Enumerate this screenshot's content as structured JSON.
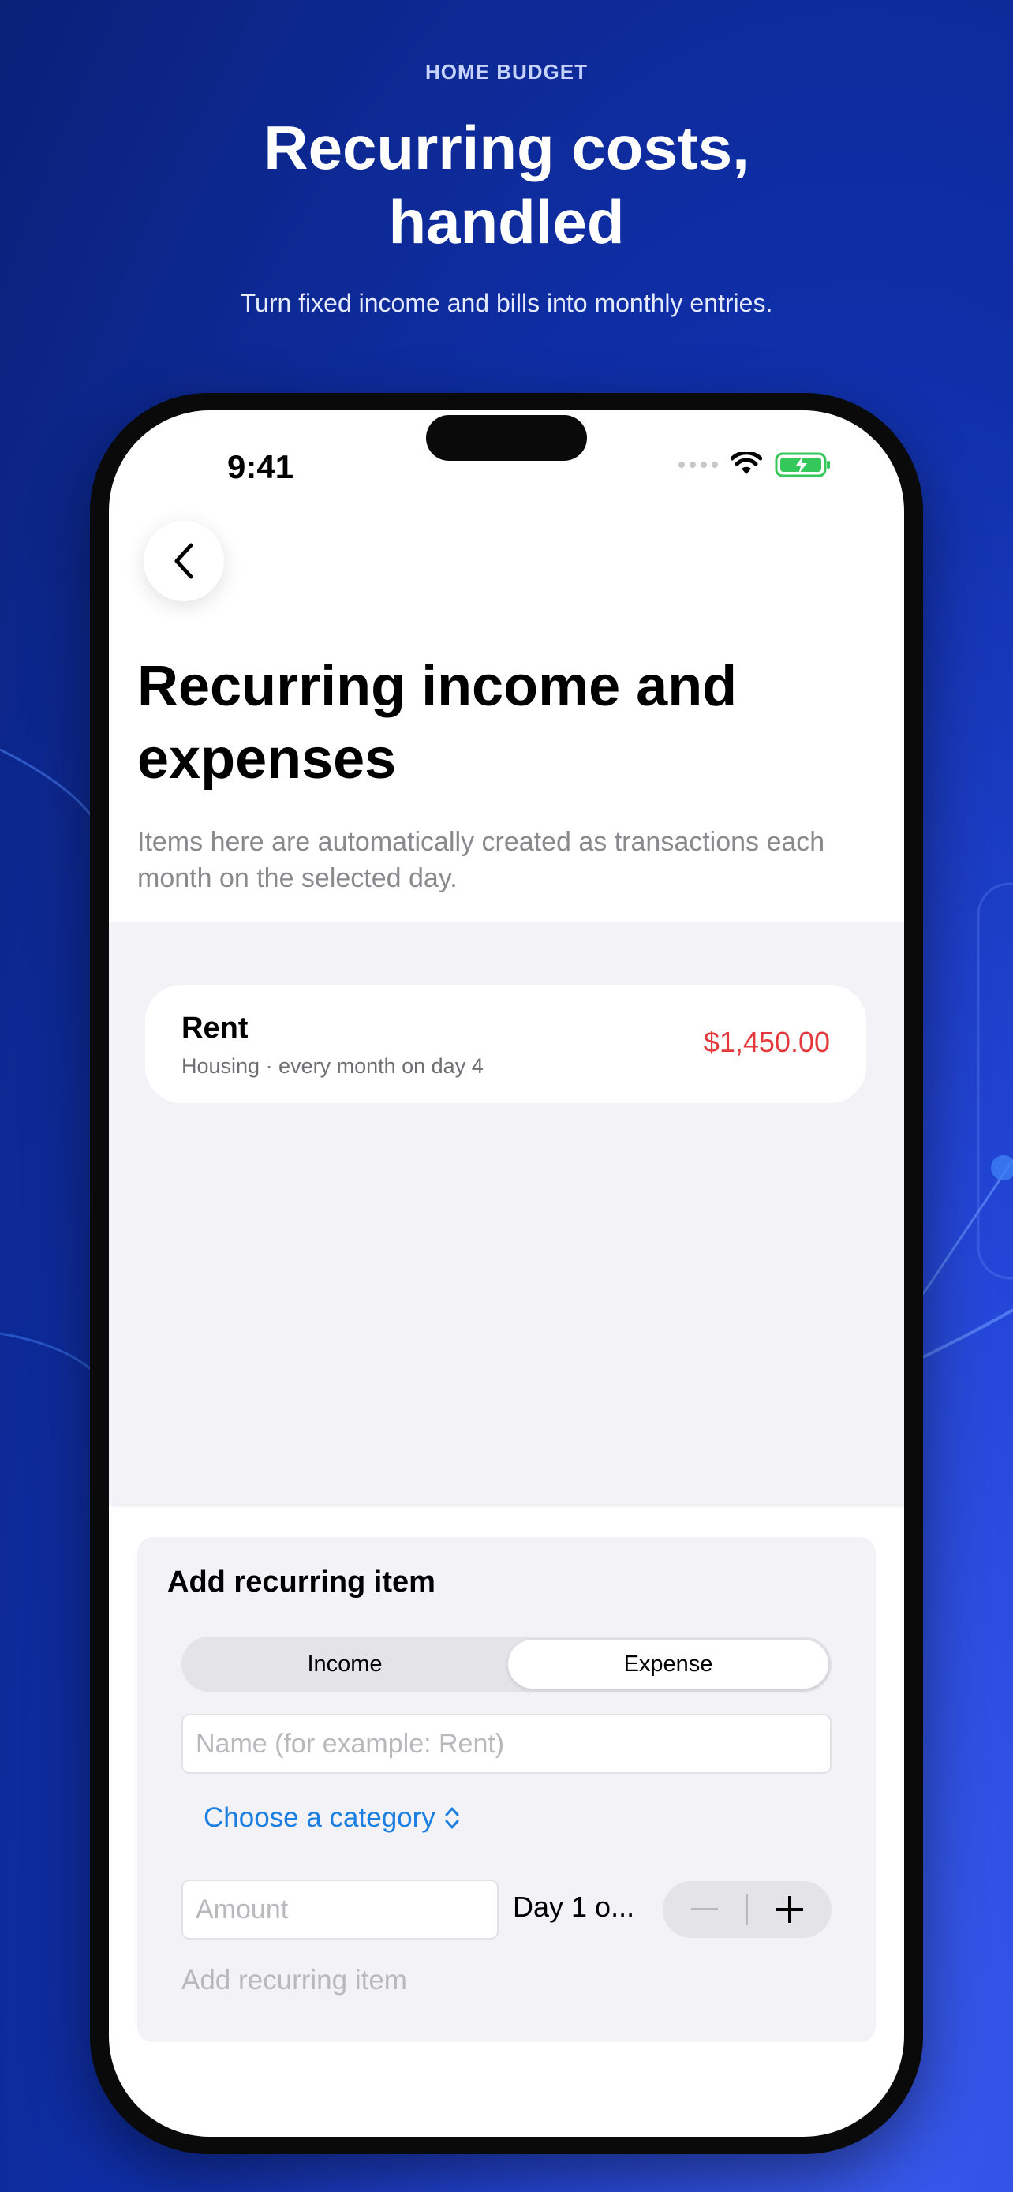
{
  "hero": {
    "eyebrow": "HOME BUDGET",
    "headline": "Recurring costs, handled",
    "subline": "Turn fixed income and bills into monthly entries."
  },
  "status_bar": {
    "time": "9:41",
    "icons": [
      "signal-dots-icon",
      "wifi-icon",
      "battery-charging-icon"
    ]
  },
  "page": {
    "back_icon": "chevron-left-icon",
    "title": "Recurring income and expenses",
    "description": "Items here are automatically created as transactions each month on the selected day."
  },
  "recurring_items": [
    {
      "name": "Rent",
      "meta": "Housing · every month on day 4",
      "amount": "$1,450.00",
      "type": "expense"
    }
  ],
  "form": {
    "title": "Add recurring item",
    "segments": [
      "Income",
      "Expense"
    ],
    "selected_segment": "Expense",
    "name_placeholder": "Name (for example: Rent)",
    "category_label": "Choose a category",
    "amount_placeholder": "Amount",
    "day_label": "Day 1 o...",
    "add_button_label": "Add recurring item"
  },
  "colors": {
    "accent_blue": "#1a7fe0",
    "expense_red": "#e5383b",
    "battery_green": "#34c759"
  }
}
